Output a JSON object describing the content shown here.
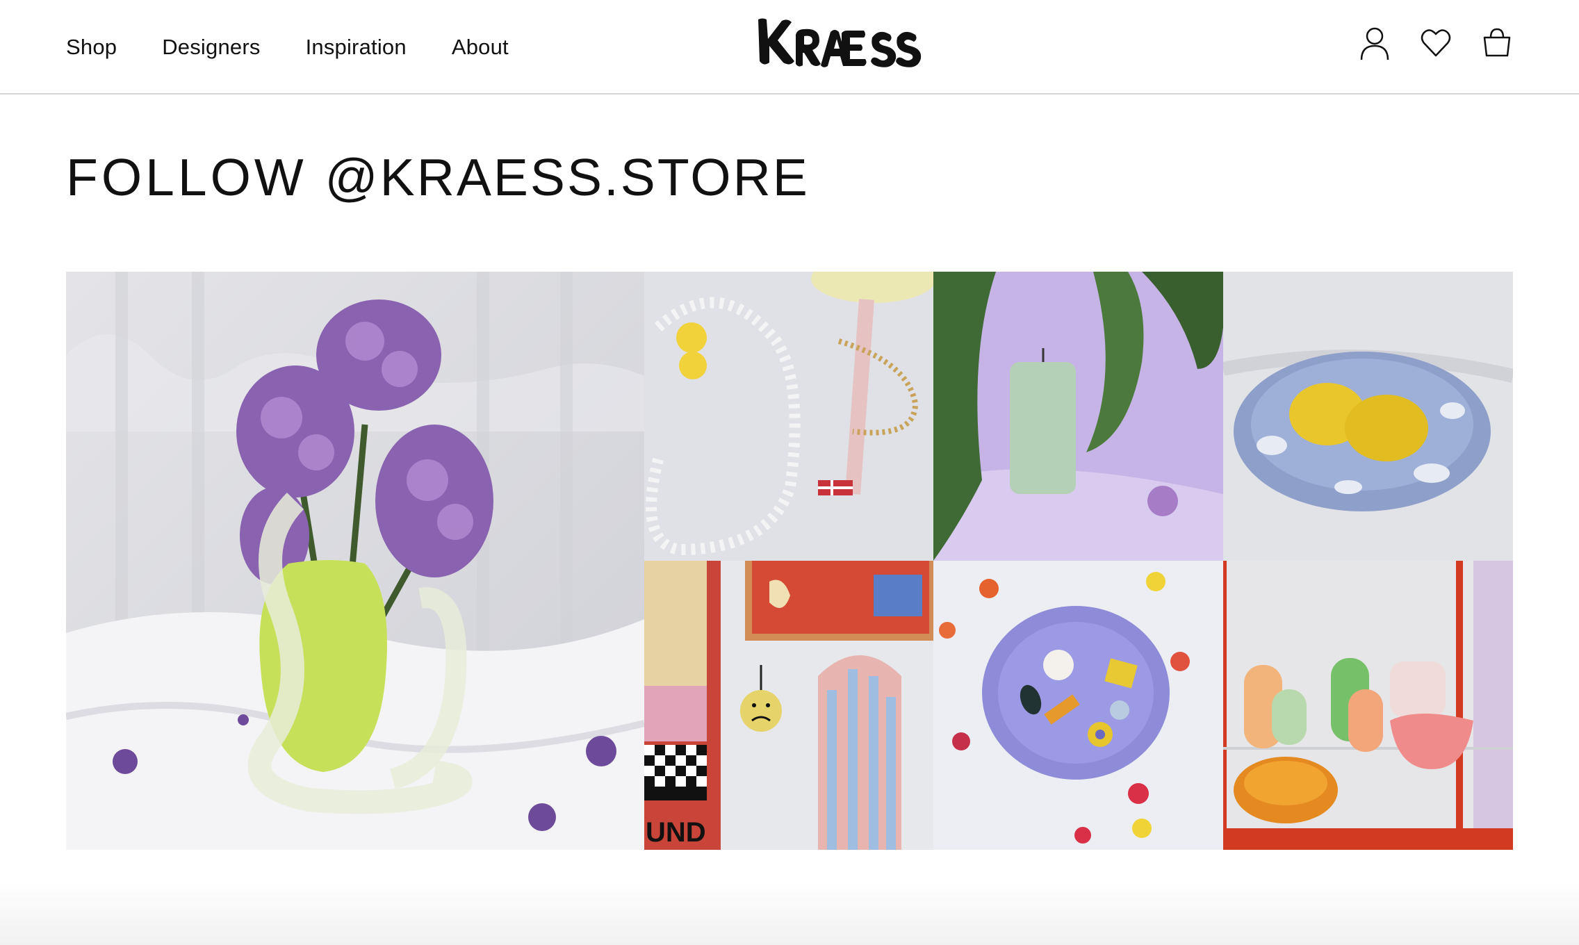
{
  "nav": {
    "items": [
      {
        "label": "Shop"
      },
      {
        "label": "Designers"
      },
      {
        "label": "Inspiration"
      },
      {
        "label": "About"
      }
    ]
  },
  "brand": {
    "logo_text": "KRÆSS"
  },
  "header_actions": {
    "icons": [
      "account-icon",
      "wishlist-heart-icon",
      "shopping-bag-icon"
    ]
  },
  "section": {
    "title_prefix": "FOLLOW",
    "handle": "@KRAESS.STORE"
  },
  "gallery": {
    "photos": [
      "lilac-flowers-in-green-vase-photo",
      "beaded-necklaces-photo",
      "sage-candle-on-lilac-paper-photo",
      "lemons-on-blue-plate-photo",
      "sad-face-ornament-wall-photo",
      "purple-bowl-with-candies-photo",
      "colorful-glass-objects-on-shelf-photo"
    ],
    "visible_text": {
      "wall_sign": "UND"
    }
  },
  "colors": {
    "text": "#111111",
    "header_border": "#d6d6d6",
    "background": "#ffffff"
  }
}
